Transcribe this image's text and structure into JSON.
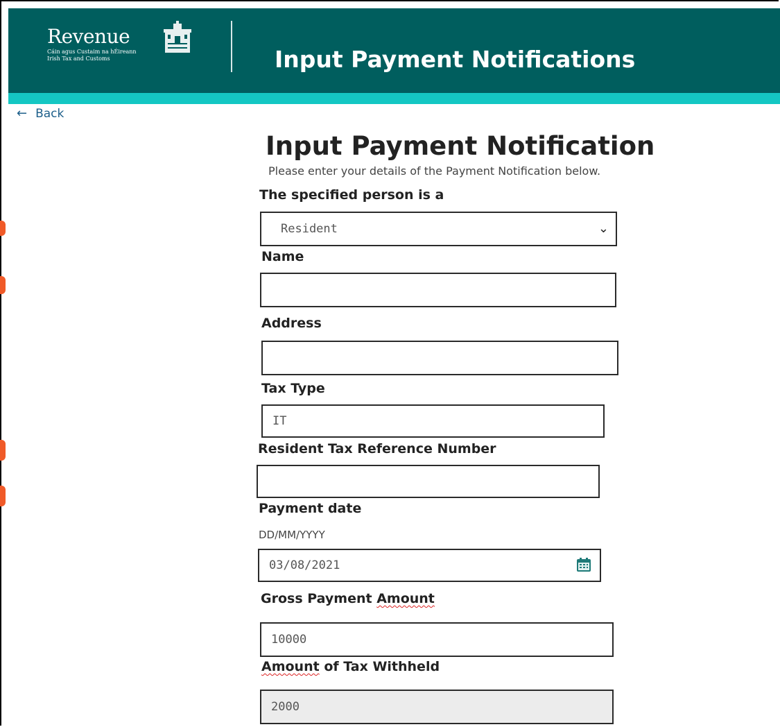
{
  "header": {
    "logo_word": "Revenue",
    "logo_sub_line1": "Cáin agus Custaim na hÉireann",
    "logo_sub_line2": "Irish Tax and Customs",
    "title": "Input Payment Notifications"
  },
  "nav": {
    "back_label": "Back"
  },
  "form": {
    "title": "Input Payment Notification",
    "subtitle": "Please enter your details of the Payment Notification below.",
    "person_type": {
      "label": "The specified person is a",
      "value": "Resident"
    },
    "name": {
      "label": "Name",
      "value": ""
    },
    "address": {
      "label": "Address",
      "value": ""
    },
    "tax_type": {
      "label": "Tax Type",
      "value": "IT"
    },
    "tax_ref": {
      "label": "Resident Tax Reference Number",
      "value": ""
    },
    "payment_date": {
      "label": "Payment date",
      "hint": "DD/MM/YYYY",
      "value": "03/08/2021"
    },
    "gross_amount": {
      "label_pre": "Gross Payment ",
      "label_word": "Amount",
      "value": "10000"
    },
    "tax_withheld": {
      "label_word": "Amount",
      "label_post": " of Tax Withheld",
      "value": "2000"
    }
  },
  "colors": {
    "header_bg": "#005e5e",
    "header_stripe": "#14c7c3",
    "link": "#1d5f8a",
    "edge_accent": "#f05a28"
  },
  "icons": [
    "harp-building-logo-icon",
    "arrow-left-icon",
    "chevron-down-icon",
    "calendar-icon"
  ]
}
